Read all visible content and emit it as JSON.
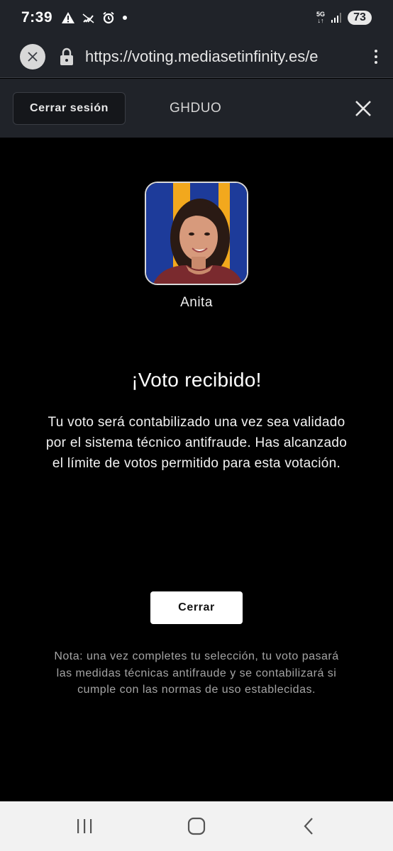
{
  "status_bar": {
    "time": "7:39",
    "network_label_top": "5G",
    "network_label_bottom": "↓↑",
    "battery": "73"
  },
  "browser": {
    "url": "https://voting.mediasetinfinity.es/e"
  },
  "header": {
    "logout_label": "Cerrar sesión",
    "title": "GHDUO"
  },
  "candidate": {
    "name": "Anita"
  },
  "confirmation": {
    "title": "¡Voto recibido!",
    "message": "Tu voto será contabilizado una vez sea validado por el sistema técnico antifraude. Has alcanzado el límite de votos permitido para esta votación.",
    "close_label": "Cerrar",
    "note": "Nota: una vez completes tu selección, tu voto pasará las medidas técnicas antifraude y se contabilizará si cumple con las normas de uso establecidas."
  },
  "colors": {
    "chrome": "#202329",
    "avatar_bg": "#1d3b9a",
    "avatar_accent": "#f2a81d"
  },
  "icons": {
    "status": [
      "warning-icon",
      "no-signal-icon",
      "alarm-icon",
      "dot-icon",
      "signal-bars-icon"
    ],
    "browser": [
      "close-icon",
      "lock-icon",
      "more-vert-icon"
    ],
    "header": [
      "close-icon"
    ],
    "nav": [
      "recent-apps-icon",
      "home-icon",
      "back-icon"
    ]
  }
}
